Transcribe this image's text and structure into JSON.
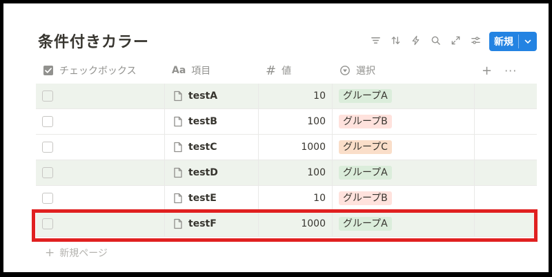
{
  "page": {
    "title": "条件付きカラー"
  },
  "toolbar": {
    "icons": [
      "filter-icon",
      "sort-icon",
      "automation-icon",
      "search-icon",
      "expand-icon",
      "settings-icon"
    ],
    "new_label": "新規"
  },
  "table": {
    "columns": [
      {
        "label": "チェックボックス",
        "icon": "checkbox-icon"
      },
      {
        "label": "項目",
        "icon": "text-type-icon",
        "icon_text": "Aa"
      },
      {
        "label": "値",
        "icon": "number-icon",
        "icon_text": "#"
      },
      {
        "label": "選択",
        "icon": "select-icon"
      }
    ],
    "add_column": "+",
    "more_menu": "···",
    "rows": [
      {
        "checked": false,
        "name": "testA",
        "value": "10",
        "group": "グループA",
        "highlighted": true
      },
      {
        "checked": false,
        "name": "testB",
        "value": "100",
        "group": "グループB",
        "highlighted": false
      },
      {
        "checked": false,
        "name": "testC",
        "value": "1000",
        "group": "グループC",
        "highlighted": false
      },
      {
        "checked": false,
        "name": "testD",
        "value": "100",
        "group": "グループA",
        "highlighted": true
      },
      {
        "checked": false,
        "name": "testE",
        "value": "10",
        "group": "グループB",
        "highlighted": false
      },
      {
        "checked": false,
        "name": "testF",
        "value": "1000",
        "group": "グループA",
        "highlighted": true
      }
    ],
    "group_colors": {
      "グループA": "#dbeddb",
      "グループB": "#ffe2dd",
      "グループC": "#fadec9"
    },
    "row_highlight_color": "#eef3ec"
  },
  "footer": {
    "new_page_plus": "+",
    "new_page_label": "新規ページ"
  },
  "annotation": {
    "highlight_color": "#e02020"
  }
}
